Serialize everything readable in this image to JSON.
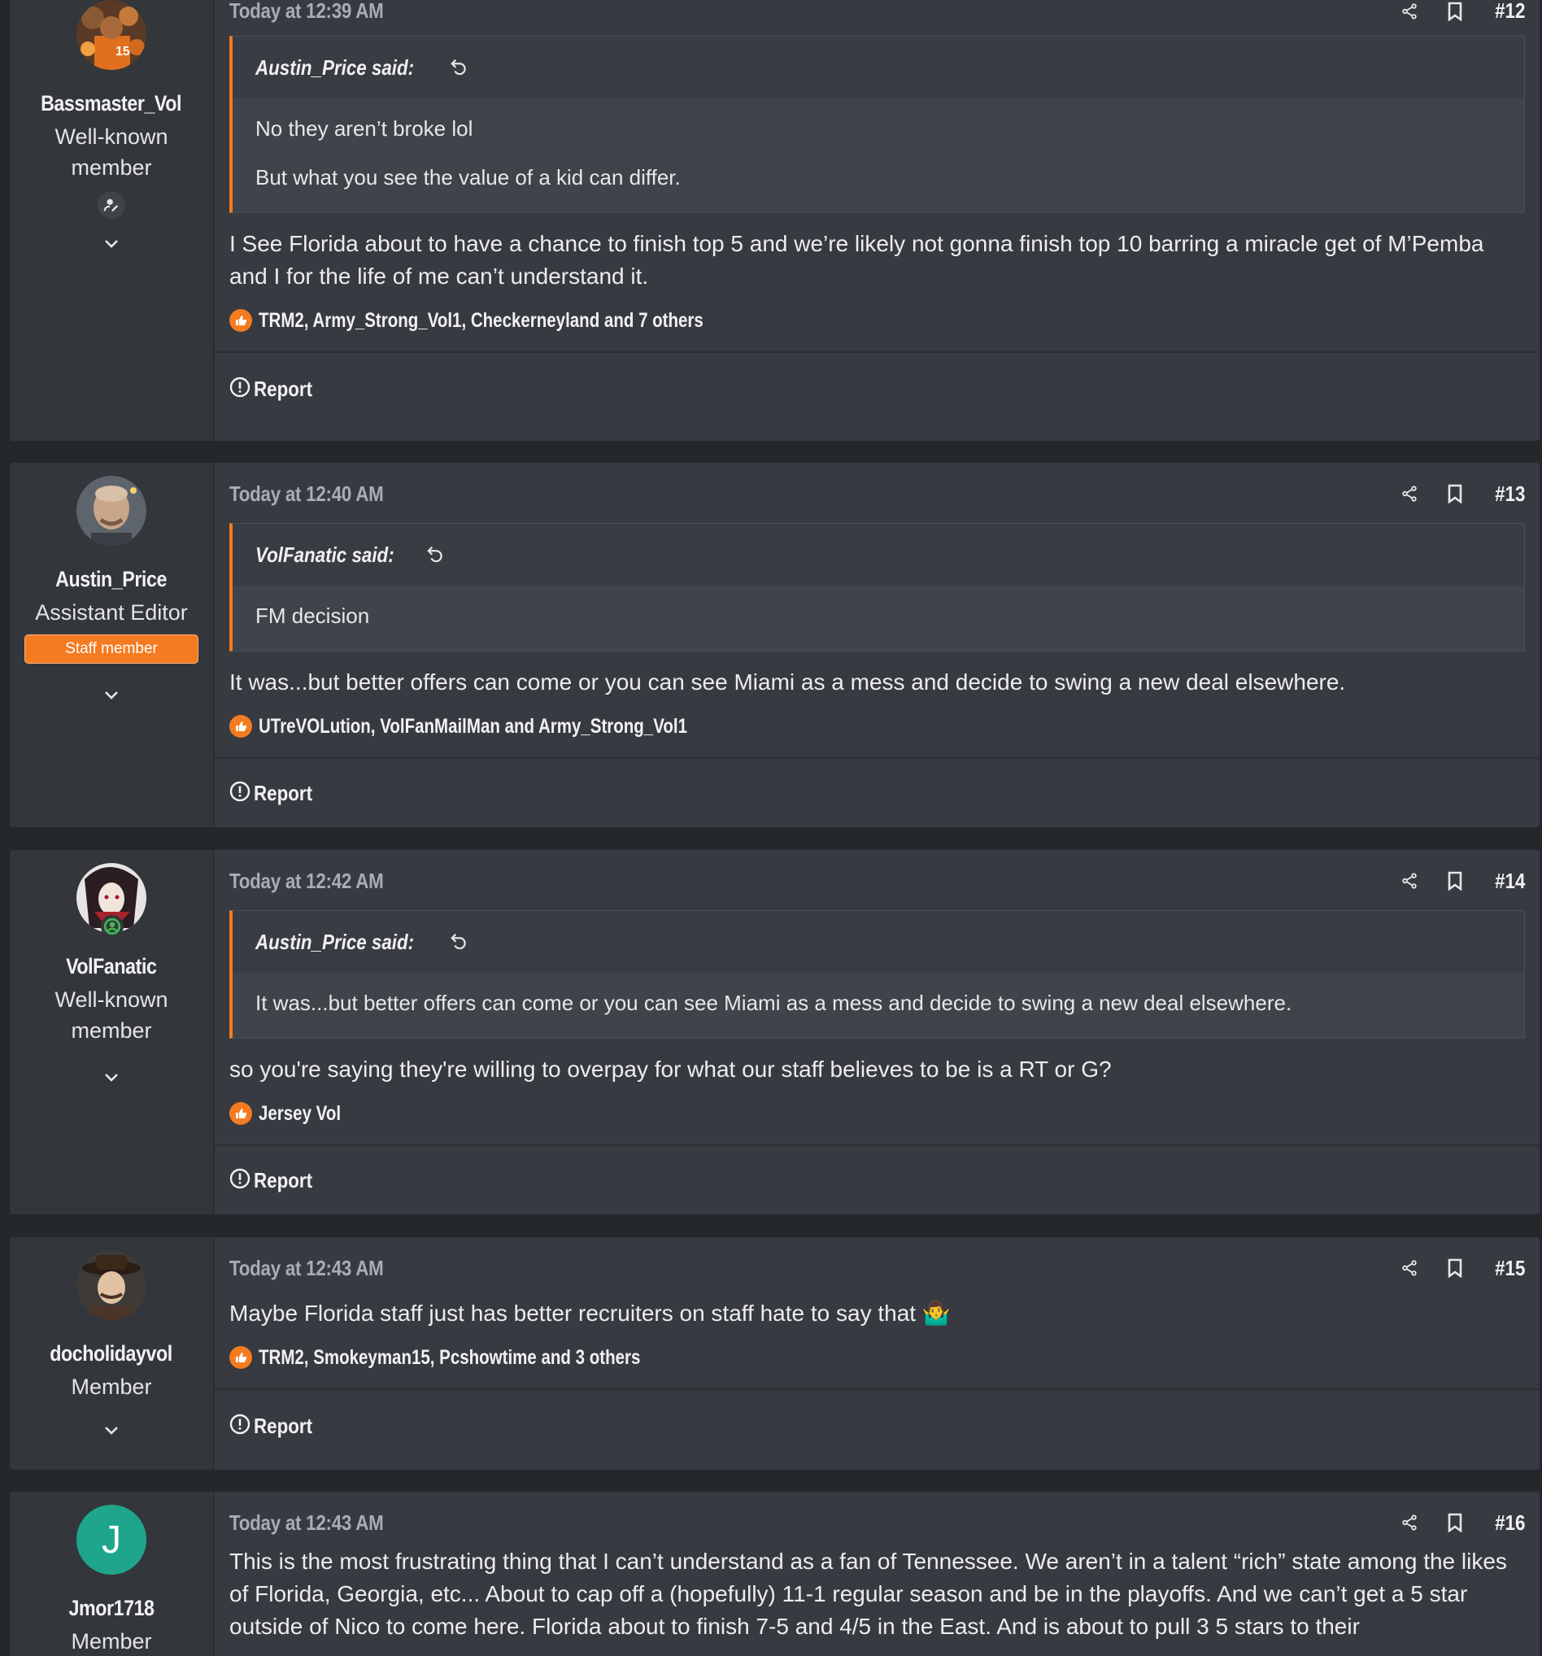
{
  "posts": [
    {
      "username": "Bassmaster_Vol",
      "title_line1": "Well-known",
      "title_line2": "member",
      "date": "Today at 12:39 AM",
      "number": "#12",
      "quote": {
        "author": "Austin_Price said:",
        "lines": [
          "No they aren’t broke lol",
          "But what you see the value of a kid can differ."
        ]
      },
      "message": "I See Florida about to have a chance to finish top 5 and we’re likely not gonna finish top 10 barring a miracle get of M’Pemba and I for the life of me can’t understand it.",
      "reactions": "TRM2, Army_Strong_Vol1, Checkerneyland and 7 others",
      "report": "Report"
    },
    {
      "username": "Austin_Price",
      "title_line1": "Assistant Editor",
      "badge": "Staff member",
      "date": "Today at 12:40 AM",
      "number": "#13",
      "quote": {
        "author": "VolFanatic said:",
        "lines": [
          "FM decision"
        ]
      },
      "message": "It was...but better offers can come or you can see Miami as a mess and decide to swing a new deal elsewhere.",
      "reactions": "UTreVOLution, VolFanMailMan and Army_Strong_Vol1",
      "report": "Report"
    },
    {
      "username": "VolFanatic",
      "title_line1": "Well-known",
      "title_line2": "member",
      "date": "Today at 12:42 AM",
      "number": "#14",
      "quote": {
        "author": "Austin_Price said:",
        "lines": [
          "It was...but better offers can come or you can see Miami as a mess and decide to swing a new deal elsewhere."
        ]
      },
      "message": "so you're saying they're willing to overpay for what our staff believes to be is a RT or G?",
      "reactions": "Jersey Vol",
      "report": "Report"
    },
    {
      "username": "docholidayvol",
      "title_line1": "Member",
      "date": "Today at 12:43 AM",
      "number": "#15",
      "message": "Maybe Florida staff just has better recruiters on staff hate to say that",
      "emoji": "🤷‍♂️",
      "reactions": "TRM2, Smokeyman15, Pcshowtime and 3 others",
      "report": "Report"
    },
    {
      "username": "Jmor1718",
      "title_line1": "Member",
      "avatar_letter": "J",
      "date": "Today at 12:43 AM",
      "number": "#16",
      "message": "This is the most frustrating thing that I can’t understand as a fan of Tennessee. We aren’t in a talent “rich” state among the likes of Florida, Georgia, etc... About to cap off a (hopefully) 11-1 regular season and be in the playoffs. And we can’t get a 5 star outside of Nico to come here. Florida about to finish 7-5 and 4/5 in the East. And is about to pull 3 5 stars to their"
    }
  ],
  "colors": {
    "accent": "#f47b20",
    "avatar_j": "#1fa58c"
  },
  "icons": [
    "share-icon",
    "bookmark-icon",
    "reply-arrow-icon",
    "thumbs-up-icon",
    "report-icon",
    "chevron-down-icon",
    "user-edit-icon",
    "online-user-icon"
  ]
}
